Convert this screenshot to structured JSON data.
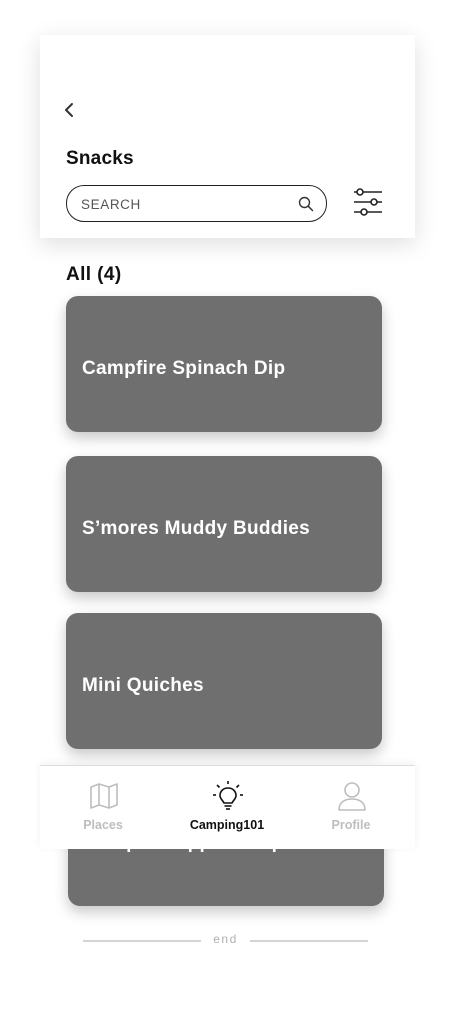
{
  "header": {
    "title": "Snacks",
    "back_icon": "chevron-left-icon",
    "search": {
      "placeholder": "SEARCH",
      "value": "",
      "icon": "search-icon"
    },
    "filter_icon": "sliders-icon"
  },
  "list": {
    "heading": "All (4)",
    "items": [
      {
        "label": "Campfire Spinach Dip"
      },
      {
        "label": "S’mores Muddy Buddies"
      },
      {
        "label": "Mini Quiches"
      },
      {
        "label": "Campfire Apple Crisp"
      }
    ],
    "end_label": "end"
  },
  "bottom_nav": {
    "items": [
      {
        "label": "Places",
        "icon": "map-icon",
        "active": false
      },
      {
        "label": "Camping101",
        "icon": "lightbulb-icon",
        "active": true
      },
      {
        "label": "Profile",
        "icon": "user-icon",
        "active": false
      }
    ]
  },
  "colors": {
    "card_background": "#6f6f6f",
    "card_text": "#ffffff",
    "nav_active": "#111111",
    "nav_inactive": "#bdbdbd"
  }
}
